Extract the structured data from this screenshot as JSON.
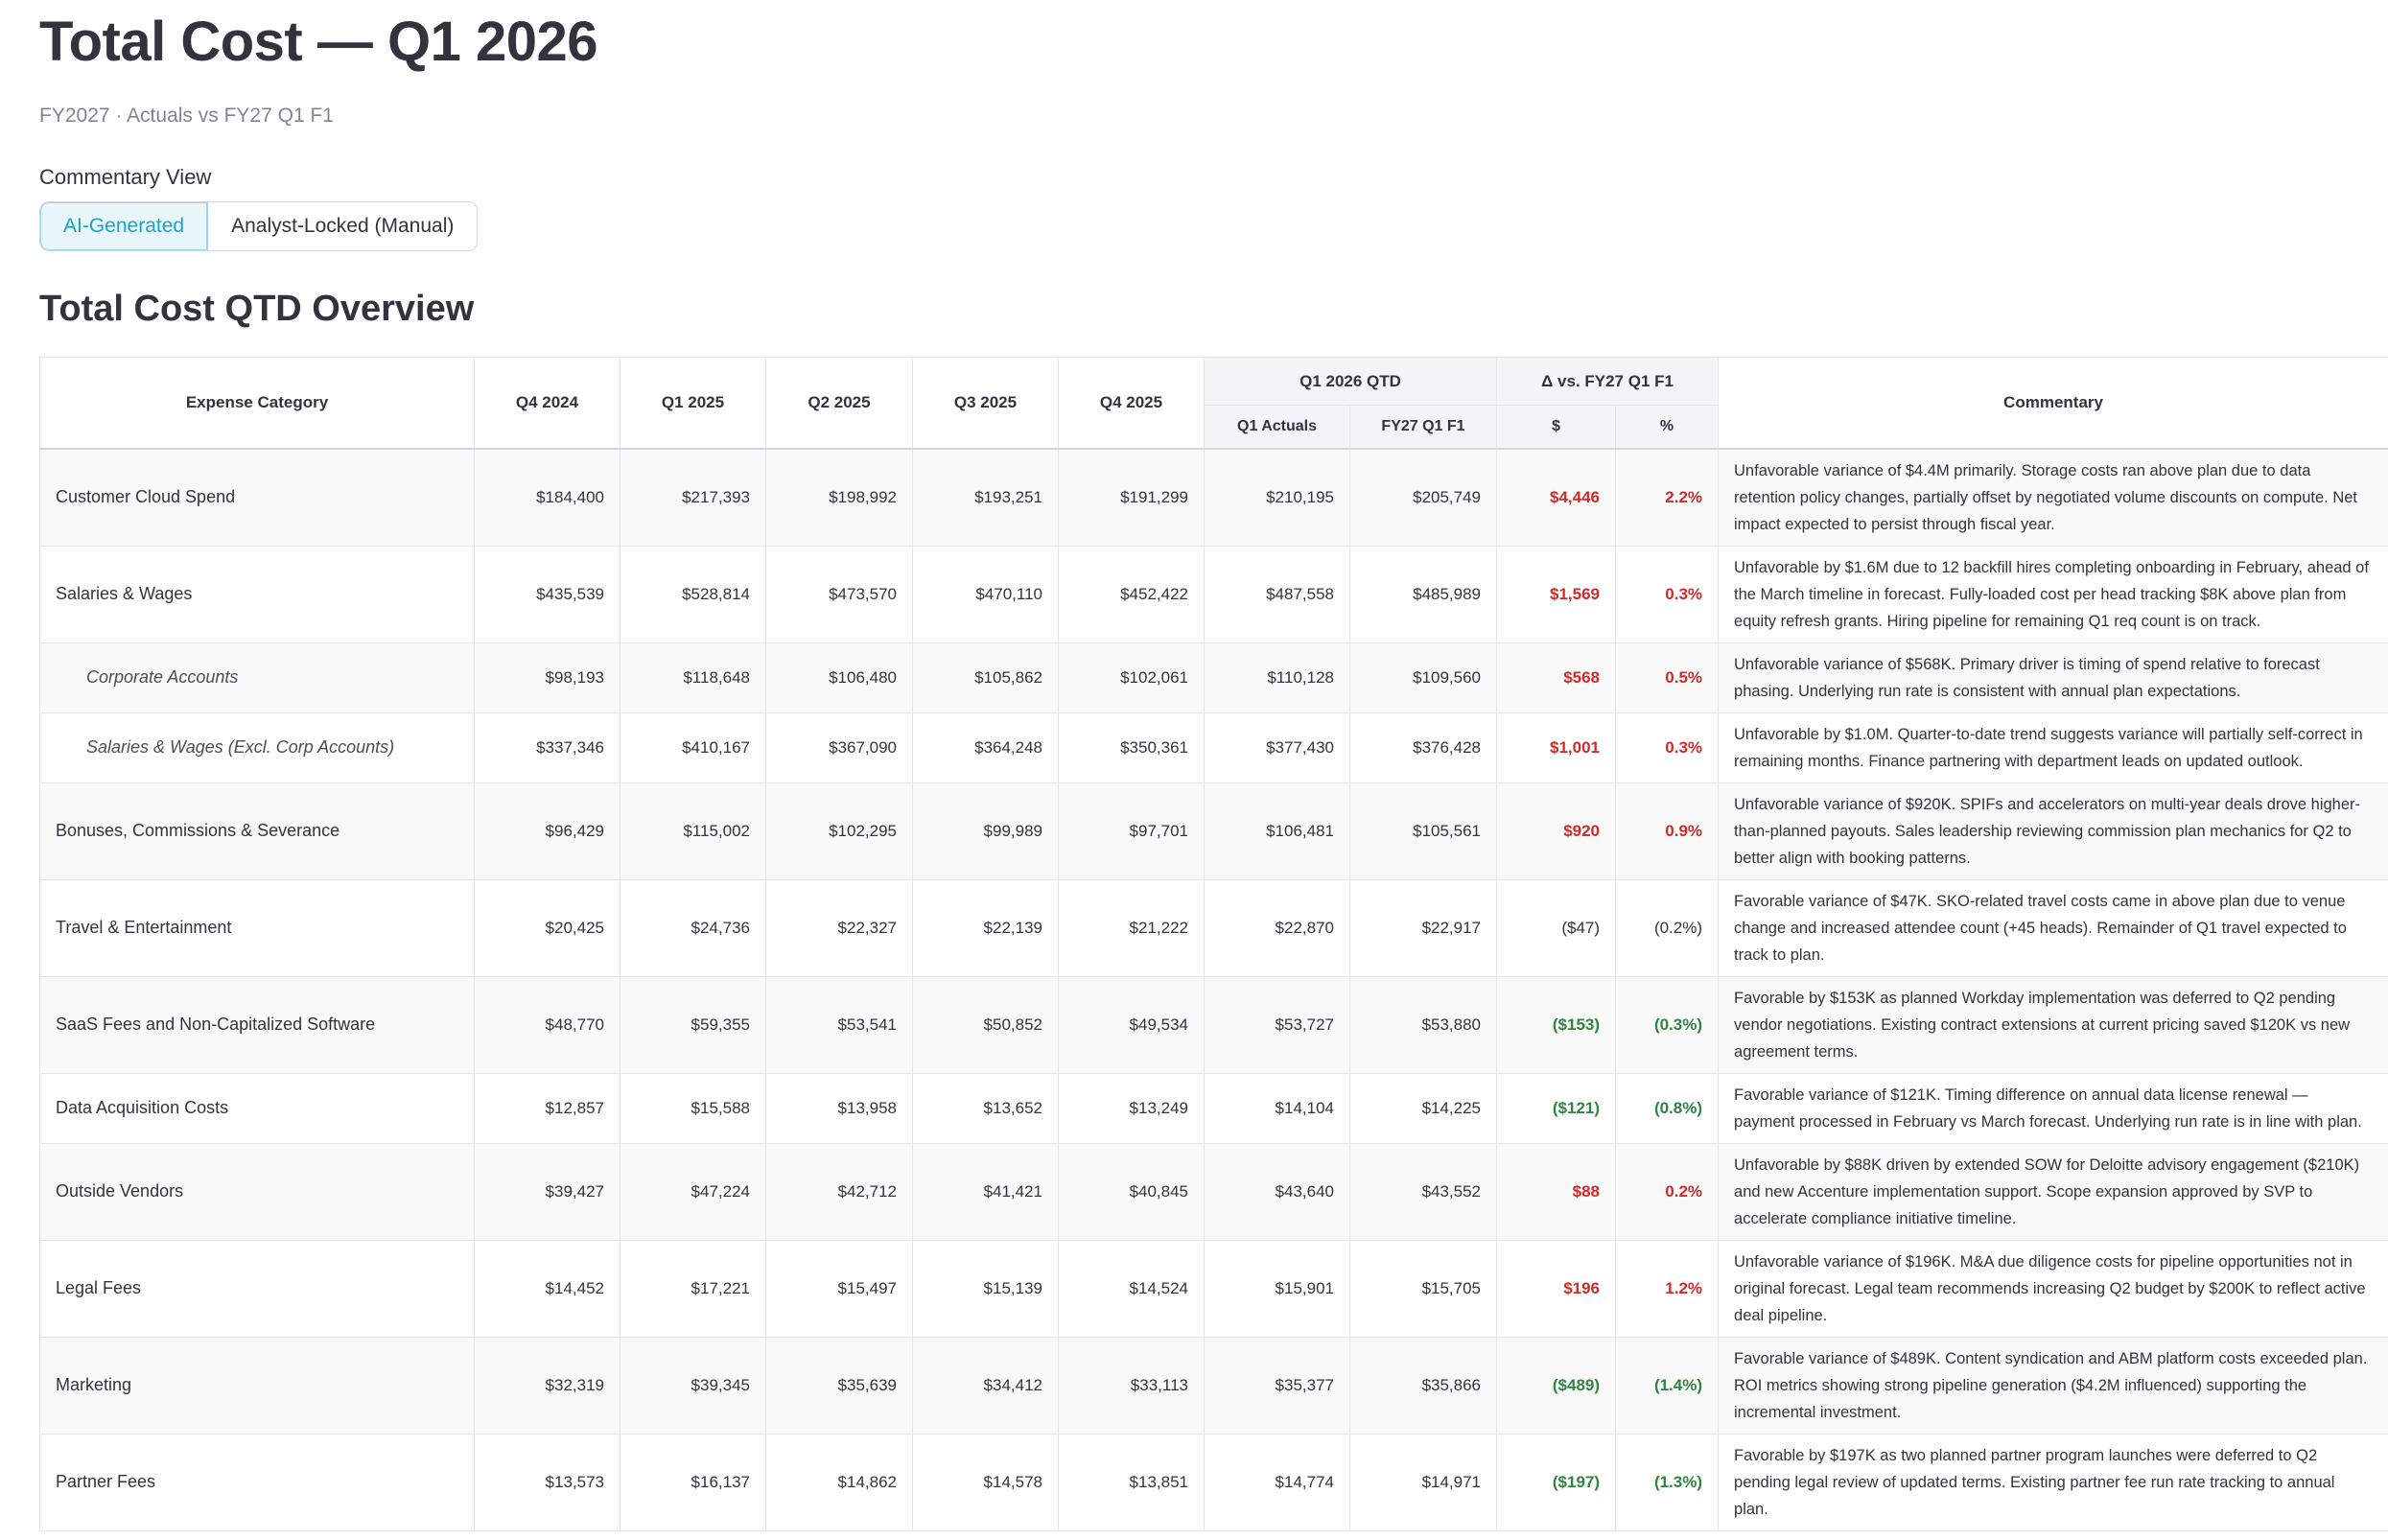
{
  "header": {
    "title": "Total Cost — Q1 2026",
    "subtitle": "FY2027 · Actuals vs FY27 Q1 F1"
  },
  "commentary_view": {
    "label": "Commentary View",
    "options": [
      "AI-Generated",
      "Analyst-Locked (Manual)"
    ],
    "selected": "AI-Generated"
  },
  "section": {
    "title": "Total Cost QTD Overview"
  },
  "table": {
    "headers": {
      "category": "Expense Category",
      "q4_2024": "Q4 2024",
      "q1_2025": "Q1 2025",
      "q2_2025": "Q2 2025",
      "q3_2025": "Q3 2025",
      "q4_2025": "Q4 2025",
      "group_qtd": "Q1 2026 QTD",
      "q1_actuals": "Q1 Actuals",
      "fy27_f1": "FY27 Q1 F1",
      "group_delta": "Δ vs. FY27 Q1 F1",
      "delta_usd": "$",
      "delta_pct": "%",
      "commentary": "Commentary"
    },
    "rows": [
      {
        "category": "Customer Cloud Spend",
        "sub": false,
        "tone": "neg",
        "lines": 3,
        "q4_2024": "$184,400",
        "q1_2025": "$217,393",
        "q2_2025": "$198,992",
        "q3_2025": "$193,251",
        "q4_2025": "$191,299",
        "q1_actuals": "$210,195",
        "fy27_f1": "$205,749",
        "delta_usd": "$4,446",
        "delta_pct": "2.2%",
        "commentary": "Unfavorable variance of $4.4M primarily. Storage costs ran above plan due to data retention policy changes, partially offset by negotiated volume discounts on compute. Net impact expected to persist through fiscal year."
      },
      {
        "category": "Salaries & Wages",
        "sub": false,
        "tone": "neg",
        "lines": 3,
        "q4_2024": "$435,539",
        "q1_2025": "$528,814",
        "q2_2025": "$473,570",
        "q3_2025": "$470,110",
        "q4_2025": "$452,422",
        "q1_actuals": "$487,558",
        "fy27_f1": "$485,989",
        "delta_usd": "$1,569",
        "delta_pct": "0.3%",
        "commentary": "Unfavorable by $1.6M due to 12 backfill hires completing onboarding in February, ahead of the March timeline in forecast. Fully-loaded cost per head tracking $8K above plan from equity refresh grants. Hiring pipeline for remaining Q1 req count is on track."
      },
      {
        "category": "Corporate Accounts",
        "sub": true,
        "tone": "neg",
        "lines": 2,
        "q4_2024": "$98,193",
        "q1_2025": "$118,648",
        "q2_2025": "$106,480",
        "q3_2025": "$105,862",
        "q4_2025": "$102,061",
        "q1_actuals": "$110,128",
        "fy27_f1": "$109,560",
        "delta_usd": "$568",
        "delta_pct": "0.5%",
        "commentary": "Unfavorable variance of $568K. Primary driver is timing of spend relative to forecast phasing. Underlying run rate is consistent with annual plan expectations."
      },
      {
        "category": "Salaries & Wages (Excl. Corp Accounts)",
        "sub": true,
        "tone": "neg",
        "lines": 2,
        "q4_2024": "$337,346",
        "q1_2025": "$410,167",
        "q2_2025": "$367,090",
        "q3_2025": "$364,248",
        "q4_2025": "$350,361",
        "q1_actuals": "$377,430",
        "fy27_f1": "$376,428",
        "delta_usd": "$1,001",
        "delta_pct": "0.3%",
        "commentary": "Unfavorable by $1.0M. Quarter-to-date trend suggests variance will partially self-correct in remaining months. Finance partnering with department leads on updated outlook."
      },
      {
        "category": "Bonuses, Commissions & Severance",
        "sub": false,
        "tone": "neg",
        "lines": 3,
        "q4_2024": "$96,429",
        "q1_2025": "$115,002",
        "q2_2025": "$102,295",
        "q3_2025": "$99,989",
        "q4_2025": "$97,701",
        "q1_actuals": "$106,481",
        "fy27_f1": "$105,561",
        "delta_usd": "$920",
        "delta_pct": "0.9%",
        "commentary": "Unfavorable variance of $920K. SPIFs and accelerators on multi-year deals drove higher-than-planned payouts. Sales leadership reviewing commission plan mechanics for Q2 to better align with booking patterns."
      },
      {
        "category": "Travel & Entertainment",
        "sub": false,
        "tone": "neu",
        "lines": 3,
        "q4_2024": "$20,425",
        "q1_2025": "$24,736",
        "q2_2025": "$22,327",
        "q3_2025": "$22,139",
        "q4_2025": "$21,222",
        "q1_actuals": "$22,870",
        "fy27_f1": "$22,917",
        "delta_usd": "($47)",
        "delta_pct": "(0.2%)",
        "commentary": "Favorable variance of $47K. SKO-related travel costs came in above plan due to venue change and increased attendee count (+45 heads). Remainder of Q1 travel expected to track to plan."
      },
      {
        "category": "SaaS Fees and Non-Capitalized Software",
        "sub": false,
        "tone": "pos",
        "lines": 3,
        "q4_2024": "$48,770",
        "q1_2025": "$59,355",
        "q2_2025": "$53,541",
        "q3_2025": "$50,852",
        "q4_2025": "$49,534",
        "q1_actuals": "$53,727",
        "fy27_f1": "$53,880",
        "delta_usd": "($153)",
        "delta_pct": "(0.3%)",
        "commentary": "Favorable by $153K as planned Workday implementation was deferred to Q2 pending vendor negotiations. Existing contract extensions at current pricing saved $120K vs new agreement terms."
      },
      {
        "category": "Data Acquisition Costs",
        "sub": false,
        "tone": "pos",
        "lines": 2,
        "q4_2024": "$12,857",
        "q1_2025": "$15,588",
        "q2_2025": "$13,958",
        "q3_2025": "$13,652",
        "q4_2025": "$13,249",
        "q1_actuals": "$14,104",
        "fy27_f1": "$14,225",
        "delta_usd": "($121)",
        "delta_pct": "(0.8%)",
        "commentary": "Favorable variance of $121K. Timing difference on annual data license renewal — payment processed in February vs March forecast. Underlying run rate is in line with plan."
      },
      {
        "category": "Outside Vendors",
        "sub": false,
        "tone": "neg",
        "lines": 3,
        "q4_2024": "$39,427",
        "q1_2025": "$47,224",
        "q2_2025": "$42,712",
        "q3_2025": "$41,421",
        "q4_2025": "$40,845",
        "q1_actuals": "$43,640",
        "fy27_f1": "$43,552",
        "delta_usd": "$88",
        "delta_pct": "0.2%",
        "commentary": "Unfavorable by $88K driven by extended SOW for Deloitte advisory engagement ($210K) and new Accenture implementation support. Scope expansion approved by SVP to accelerate compliance initiative timeline."
      },
      {
        "category": "Legal Fees",
        "sub": false,
        "tone": "neg",
        "lines": 3,
        "q4_2024": "$14,452",
        "q1_2025": "$17,221",
        "q2_2025": "$15,497",
        "q3_2025": "$15,139",
        "q4_2025": "$14,524",
        "q1_actuals": "$15,901",
        "fy27_f1": "$15,705",
        "delta_usd": "$196",
        "delta_pct": "1.2%",
        "commentary": "Unfavorable variance of $196K. M&A due diligence costs for pipeline opportunities not in original forecast. Legal team recommends increasing Q2 budget by $200K to reflect active deal pipeline."
      },
      {
        "category": "Marketing",
        "sub": false,
        "tone": "pos",
        "lines": 3,
        "q4_2024": "$32,319",
        "q1_2025": "$39,345",
        "q2_2025": "$35,639",
        "q3_2025": "$34,412",
        "q4_2025": "$33,113",
        "q1_actuals": "$35,377",
        "fy27_f1": "$35,866",
        "delta_usd": "($489)",
        "delta_pct": "(1.4%)",
        "commentary": "Favorable variance of $489K. Content syndication and ABM platform costs exceeded plan. ROI metrics showing strong pipeline generation ($4.2M influenced) supporting the incremental investment."
      },
      {
        "category": "Partner Fees",
        "sub": false,
        "tone": "pos",
        "lines": 3,
        "q4_2024": "$13,573",
        "q1_2025": "$16,137",
        "q2_2025": "$14,862",
        "q3_2025": "$14,578",
        "q4_2025": "$13,851",
        "q1_actuals": "$14,774",
        "fy27_f1": "$14,971",
        "delta_usd": "($197)",
        "delta_pct": "(1.3%)",
        "commentary": "Favorable by $197K as two planned partner program launches were deferred to Q2 pending legal review of updated terms. Existing partner fee run rate tracking to annual plan."
      }
    ]
  }
}
